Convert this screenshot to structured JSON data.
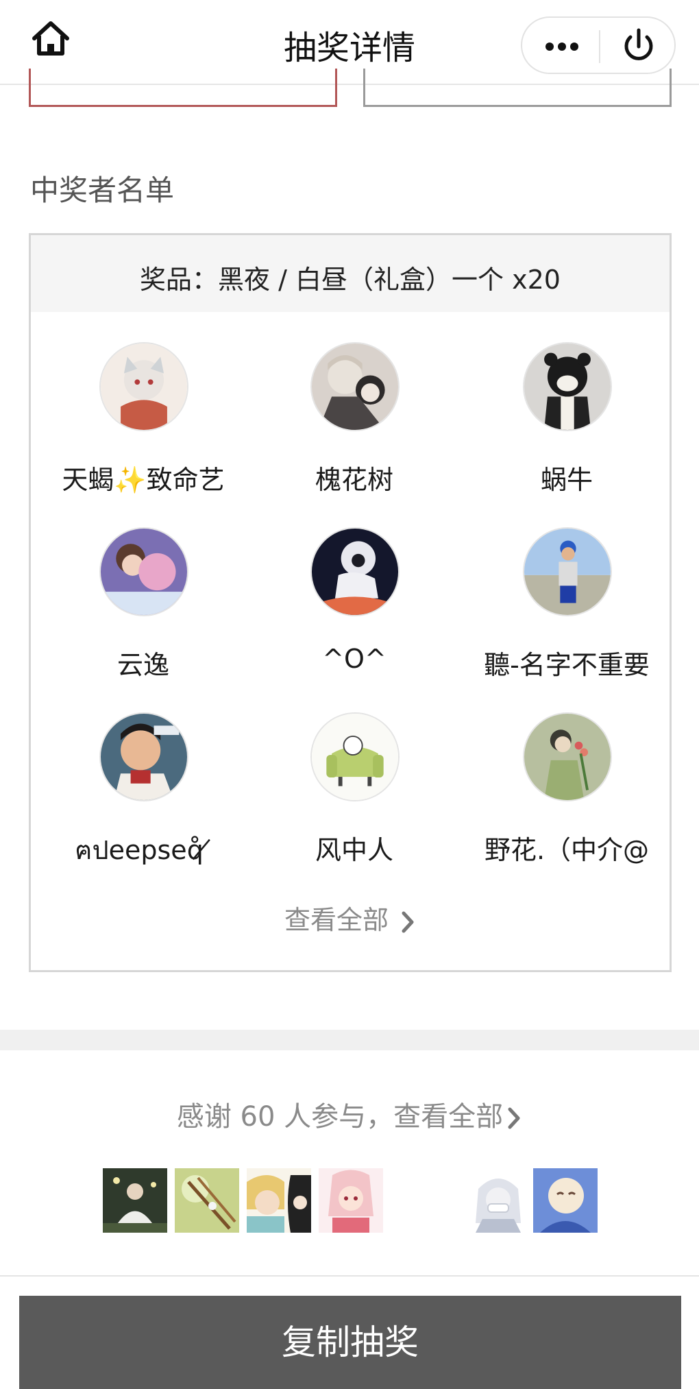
{
  "header": {
    "title": "抽奖详情",
    "home_icon": "home-icon",
    "more_icon": "more-dots-icon",
    "power_icon": "power-icon"
  },
  "winners_section": {
    "title": "中奖者名单",
    "prize": "奖品：黑夜 / 白昼（礼盒）一个 x20",
    "winners": [
      {
        "name": "天蝎✨致命艺"
      },
      {
        "name": "槐花树"
      },
      {
        "name": "蜗牛"
      },
      {
        "name": "云逸"
      },
      {
        "name": "^O^"
      },
      {
        "name": "聽-名字不重要"
      },
      {
        "name": "ฅปeepseq̊ ̸"
      },
      {
        "name": "风中人"
      },
      {
        "name": "野花.（中介@"
      }
    ],
    "view_all": "查看全部"
  },
  "participants": {
    "thanks_text": "感谢 60 人参与，查看全部"
  },
  "footer": {
    "copy_button": "复制抽奖"
  },
  "colors": {
    "primary_button": "#5a5a5a",
    "accent_border": "#b25757",
    "muted_text": "#8a8a8a"
  }
}
